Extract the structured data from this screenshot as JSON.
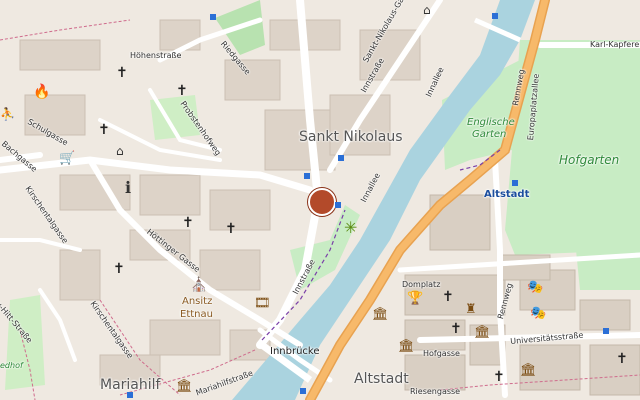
{
  "map": {
    "districts": {
      "sankt_nikolaus": "Sankt Nikolaus",
      "mariahilf": "Mariahilf",
      "altstadt": "Altstadt"
    },
    "parks": {
      "englischer_garten_line1": "Englische",
      "englischer_garten_line2": "Garten",
      "hofgarten": "Hofgarten"
    },
    "streets": {
      "hoehenstrasse": "Höhenstraße",
      "riedgasse": "Riedgasse",
      "probstenhofweg": "Probstenhofweg",
      "schulgasse": "Schulgasse",
      "bachgasse": "Bachgasse",
      "kirschentalgasse": "Kirschentalgasse",
      "hoettinger_gasse": "Höttinger Gasse",
      "innstrasse_top": "Innstraße",
      "innstrasse_bottom": "Innstraße",
      "innallee_top": "Innallee",
      "innallee_bottom": "Innallee",
      "sankt_nikolaus_gasse": "Sankt-Nikolaus-Ga",
      "kirchgasse": "Kirchgasse",
      "kirschentalgasse_lower": "Kirschentalgasse",
      "mariahilfstrasse": "Mariahilfstraße",
      "rennweg_top": "Rennweg",
      "rennweg_bottom": "Rennweg",
      "europaplatzallee": "Europaplatzallee",
      "karl_kapferer": "Karl-Kapferer",
      "universitaetsstrasse": "Universitätsstraße",
      "hofgasse": "Hofgasse",
      "riesengasse": "Riesengasse",
      "domplatz": "Domplatz",
      "hoettinger_stra": "Hötting",
      "rnhitt_strasse": "u-Hitt-Straße",
      "hochstrasse": "Hochstraße",
      "hochstrasse_alt": "Hochstraße"
    },
    "places": {
      "innbruecke": "Innbrücke",
      "ansitz_line1": "Ansitz",
      "ansitz_line2": "Ettnau",
      "altstadt_stop": "Altstadt",
      "edhof": "edhof"
    },
    "colors": {
      "river": "#aad3df",
      "park": "#c8ecc4",
      "main_road": "#f7b96a",
      "marker": "#b34a2a",
      "transit_stop": "#2b6fd6"
    }
  }
}
